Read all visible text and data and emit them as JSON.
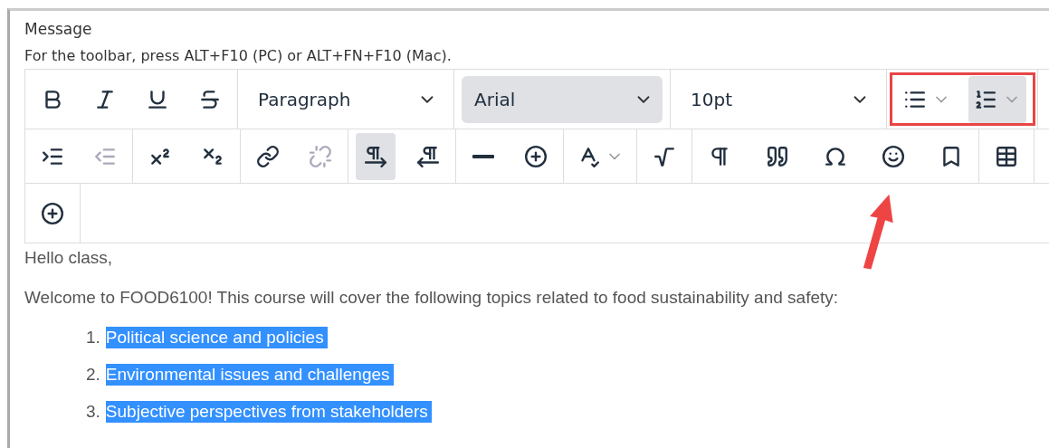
{
  "field": {
    "label": "Message",
    "hint": "For the toolbar, press ALT+F10 (PC) or ALT+FN+F10 (Mac)."
  },
  "toolbar": {
    "rows": [
      {
        "groups": [
          {
            "items": [
              {
                "kind": "button",
                "active": false,
                "disabled": false
              },
              {
                "kind": "button",
                "active": false,
                "disabled": false
              },
              {
                "kind": "button",
                "active": false,
                "disabled": false
              },
              {
                "kind": "button",
                "active": false,
                "disabled": false
              }
            ]
          },
          {
            "items": [
              {
                "kind": "select",
                "value": "Paragraph",
                "active": false
              }
            ]
          },
          {
            "items": [
              {
                "kind": "select",
                "value": "Arial",
                "active": true
              }
            ]
          },
          {
            "items": [
              {
                "kind": "select",
                "value": "10pt",
                "active": false
              }
            ]
          },
          {
            "highlighted": true,
            "items": [
              {
                "kind": "split",
                "active": false,
                "disabled": false
              },
              {
                "kind": "split",
                "active": true,
                "disabled": false
              }
            ]
          }
        ]
      },
      {
        "groups": [
          {
            "items": [
              {
                "kind": "button",
                "active": false,
                "disabled": false
              },
              {
                "kind": "button",
                "active": false,
                "disabled": true
              }
            ]
          },
          {
            "items": [
              {
                "kind": "button",
                "active": false,
                "disabled": false
              },
              {
                "kind": "button",
                "active": false,
                "disabled": false
              }
            ]
          },
          {
            "items": [
              {
                "kind": "button",
                "active": false,
                "disabled": false
              },
              {
                "kind": "button",
                "active": false,
                "disabled": true
              }
            ]
          },
          {
            "items": [
              {
                "kind": "button",
                "active": true,
                "disabled": false
              },
              {
                "kind": "button",
                "active": false,
                "disabled": false
              }
            ]
          },
          {
            "items": [
              {
                "kind": "button",
                "active": false,
                "disabled": false
              },
              {
                "kind": "button",
                "active": false,
                "disabled": false
              }
            ]
          },
          {
            "items": [
              {
                "kind": "split",
                "active": false,
                "disabled": false
              }
            ]
          },
          {
            "items": [
              {
                "kind": "button",
                "active": false,
                "disabled": false
              }
            ]
          },
          {
            "items": [
              {
                "kind": "button",
                "active": false,
                "disabled": false
              },
              {
                "kind": "button",
                "active": false,
                "disabled": false
              },
              {
                "kind": "button",
                "active": false,
                "disabled": false
              },
              {
                "kind": "button",
                "active": false,
                "disabled": false
              },
              {
                "kind": "button",
                "active": false,
                "disabled": false
              }
            ]
          },
          {
            "items": [
              {
                "kind": "button",
                "active": false,
                "disabled": false
              }
            ]
          }
        ]
      },
      {
        "groups": [
          {
            "items": [
              {
                "kind": "button",
                "active": false,
                "disabled": false
              }
            ]
          }
        ]
      }
    ]
  },
  "content": {
    "paragraphs": [
      "Hello class,",
      "Welcome to FOOD6100! This course will cover the following topics related to food sustainability and safety:"
    ],
    "list": [
      {
        "number": "1.",
        "text": "Political science and policies",
        "selected": true
      },
      {
        "number": "2.",
        "text": "Environmental issues and challenges",
        "selected": true
      },
      {
        "number": "3.",
        "text": "Subjective perspectives from stakeholders",
        "selected": true
      }
    ]
  },
  "annotation": {
    "arrow": true
  }
}
